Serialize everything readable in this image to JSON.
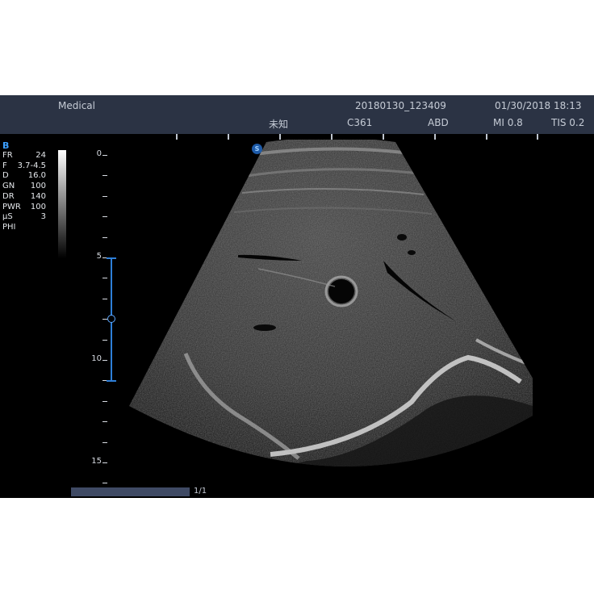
{
  "header": {
    "app_name": "Medical",
    "study_id": "20180130_123409",
    "datetime": "01/30/2018 18:13",
    "patient_name": "未知",
    "probe": "C361",
    "preset": "ABD",
    "mi": "MI 0.8",
    "tis": "TIS 0.2"
  },
  "mode": "B",
  "params": [
    {
      "label": "FR",
      "value": "24"
    },
    {
      "label": "F",
      "value": "3.7-4.5"
    },
    {
      "label": "D",
      "value": "16.0"
    },
    {
      "label": "GN",
      "value": "100"
    },
    {
      "label": "DR",
      "value": "140"
    },
    {
      "label": "PWR",
      "value": "100"
    },
    {
      "label": "μS",
      "value": "3"
    },
    {
      "label": "PHI",
      "value": ""
    }
  ],
  "depth_scale": {
    "labels": [
      "0",
      "5",
      "10",
      "15"
    ],
    "unit_max": 16.0,
    "focus_range": [
      5,
      11
    ],
    "focus_point": 8
  },
  "orientation_marker": "S",
  "cine": {
    "counter": "1/1"
  },
  "colors": {
    "header_bg": "#2b3344",
    "mode_label": "#3da0ff",
    "focus": "#2e7fd8",
    "cine_bar": "#3f4a64"
  }
}
